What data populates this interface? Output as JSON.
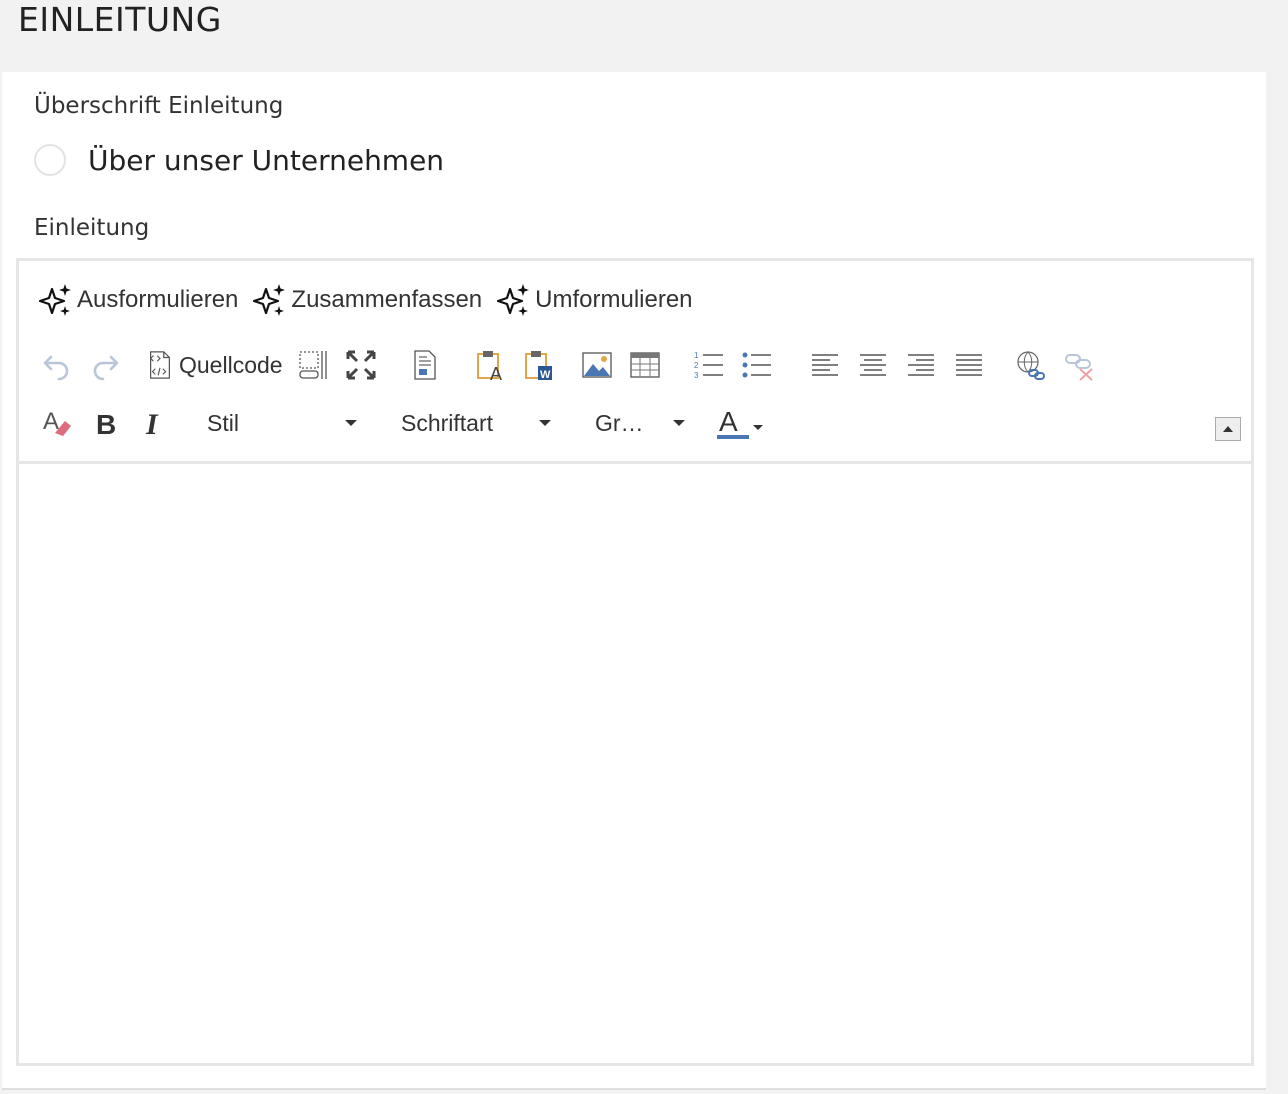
{
  "section": {
    "title": "EINLEITUNG"
  },
  "heading_field": {
    "label": "Überschrift Einleitung",
    "option_label": "Über unser Unternehmen"
  },
  "intro_field": {
    "label": "Einleitung"
  },
  "editor": {
    "ai_actions": [
      {
        "label": "Ausformulieren",
        "icon": "sparkles-icon"
      },
      {
        "label": "Zusammenfassen",
        "icon": "sparkles-icon"
      },
      {
        "label": "Umformulieren",
        "icon": "sparkles-icon"
      }
    ],
    "toolbar": {
      "source_label": "Quellcode",
      "style_label": "Stil",
      "font_label": "Schriftart",
      "size_label": "Gr…"
    },
    "content": ""
  },
  "colors": {
    "accent_blue": "#4a77b4",
    "paste_orange": "#e2a64a",
    "eraser_pink": "#e06b7d",
    "disabled_gray": "#b8c6d8"
  }
}
